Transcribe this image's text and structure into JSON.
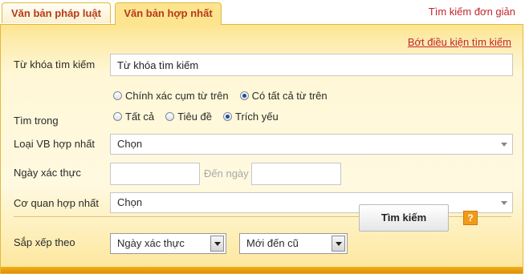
{
  "tabs": [
    {
      "label": "Văn bản pháp luật"
    },
    {
      "label": "Văn bản hợp nhất"
    }
  ],
  "simple_search_link": "Tìm kiếm đơn giản",
  "advanced_toggle_link": "Bớt điều kiện tìm kiếm",
  "keyword": {
    "label": "Từ khóa tìm kiếm",
    "value": "Từ khóa tìm kiếm"
  },
  "match_options": [
    {
      "label": "Chính xác cụm từ trên",
      "selected": false
    },
    {
      "label": "Có tất cả từ trên",
      "selected": true
    }
  ],
  "search_in": {
    "label": "Tìm trong",
    "options": [
      {
        "label": "Tất cả",
        "selected": false
      },
      {
        "label": "Tiêu đề",
        "selected": false
      },
      {
        "label": "Trích yếu",
        "selected": true
      }
    ]
  },
  "doc_type": {
    "label": "Loại VB hợp nhất",
    "value": "Chọn"
  },
  "date": {
    "label": "Ngày xác thực",
    "from_value": "",
    "to_label": "Đến ngày",
    "to_value": ""
  },
  "agency": {
    "label": "Cơ quan hợp nhất",
    "value": "Chọn"
  },
  "sort": {
    "label": "Sắp xếp theo",
    "field_value": "Ngày xác thực",
    "order_value": "Mới đến cũ"
  },
  "search_button": "Tìm kiếm",
  "help_icon_glyph": "?",
  "colors": {
    "accent": "#c0272d",
    "panel": "#fde48f",
    "bar": "#f3b019"
  }
}
